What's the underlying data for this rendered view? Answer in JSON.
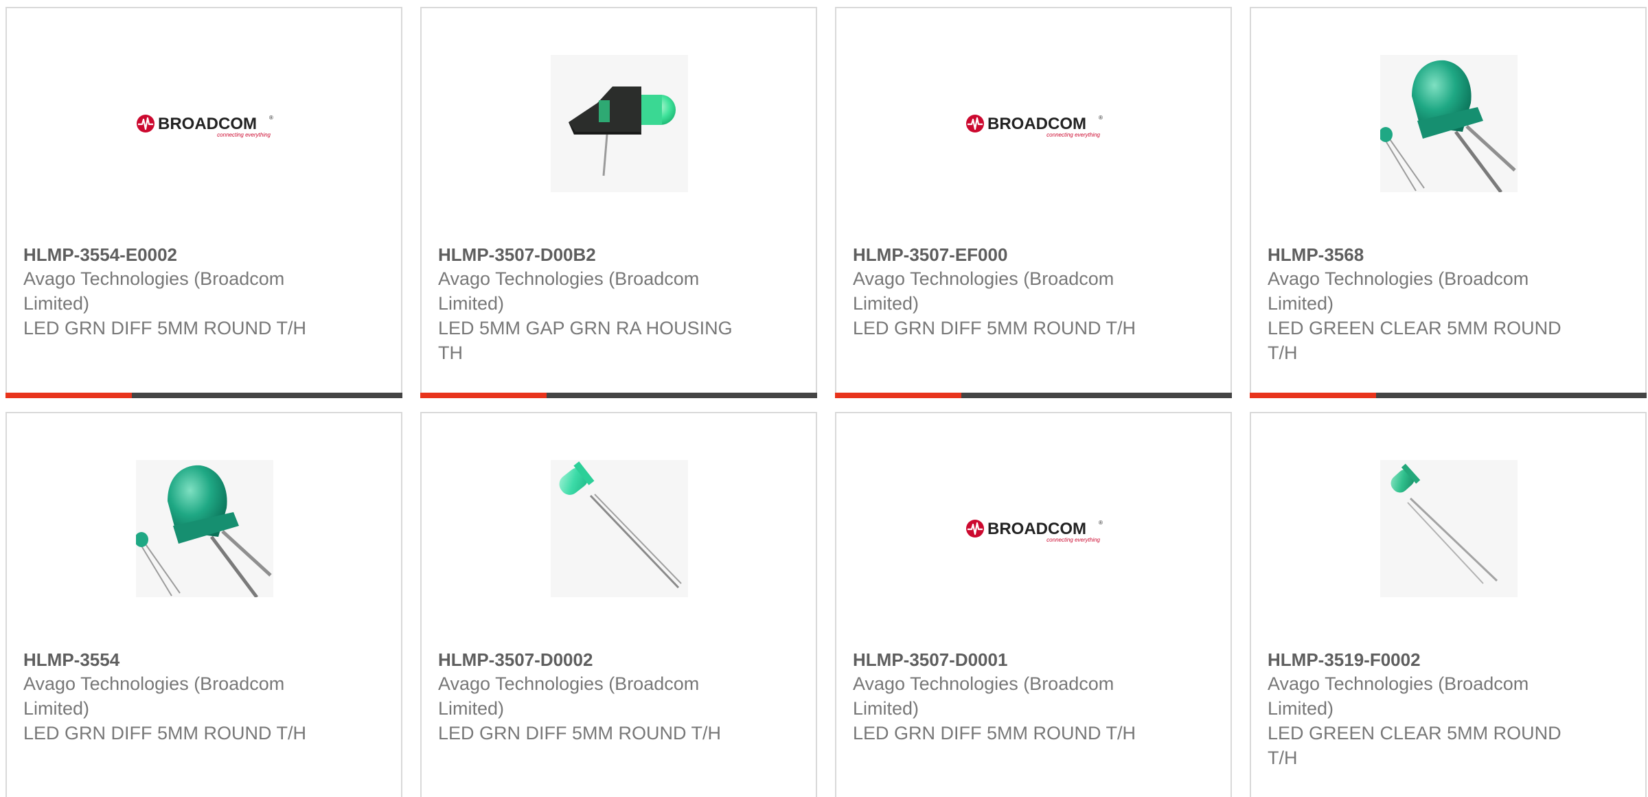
{
  "brand": {
    "accent_color": "#e8341c",
    "bar_color": "#444444"
  },
  "logo": {
    "text": "BROADCOM",
    "trademark": "®",
    "tagline": "connecting everything"
  },
  "products": [
    {
      "part_number": "HLMP-3554-E0002",
      "manufacturer": "Avago Technologies (Broadcom Limited)",
      "description": "LED GRN DIFF 5MM ROUND T/H",
      "image": "broadcom-logo"
    },
    {
      "part_number": "HLMP-3507-D00B2",
      "manufacturer": "Avago Technologies (Broadcom Limited)",
      "description": "LED 5MM GAP GRN RA HOUSING TH",
      "image": "right-angle-led-housing"
    },
    {
      "part_number": "HLMP-3507-EF000",
      "manufacturer": "Avago Technologies (Broadcom Limited)",
      "description": "LED GRN DIFF 5MM ROUND T/H",
      "image": "broadcom-logo"
    },
    {
      "part_number": "HLMP-3568",
      "manufacturer": "Avago Technologies (Broadcom Limited)",
      "description": "LED GREEN CLEAR 5MM ROUND T/H",
      "image": "flanged-led-pair"
    },
    {
      "part_number": "HLMP-3554",
      "manufacturer": "Avago Technologies (Broadcom Limited)",
      "description": "LED GRN DIFF 5MM ROUND T/H",
      "image": "flanged-led-pair"
    },
    {
      "part_number": "HLMP-3507-D0002",
      "manufacturer": "Avago Technologies (Broadcom Limited)",
      "description": "LED GRN DIFF 5MM ROUND T/H",
      "image": "diagonal-led"
    },
    {
      "part_number": "HLMP-3507-D0001",
      "manufacturer": "Avago Technologies (Broadcom Limited)",
      "description": "LED GRN DIFF 5MM ROUND T/H",
      "image": "broadcom-logo"
    },
    {
      "part_number": "HLMP-3519-F0002",
      "manufacturer": "Avago Technologies (Broadcom Limited)",
      "description": "LED GREEN CLEAR 5MM ROUND T/H",
      "image": "small-led"
    }
  ]
}
